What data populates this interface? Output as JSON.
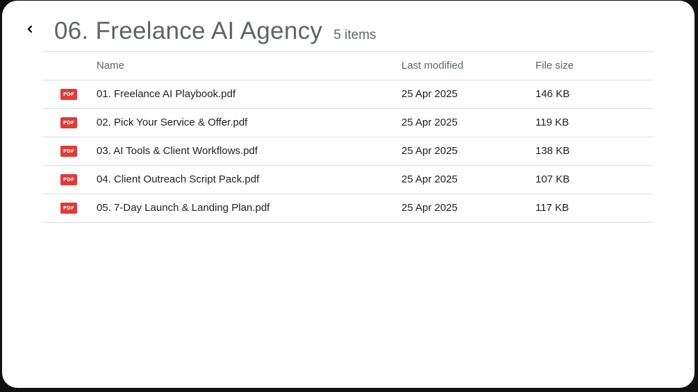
{
  "header": {
    "back_icon": "chevron-left-icon",
    "title": "06. Freelance AI Agency",
    "item_count": "5 items"
  },
  "table": {
    "columns": {
      "name": "Name",
      "last_modified": "Last modified",
      "file_size": "File size"
    },
    "file_icon_label": "PDF",
    "rows": [
      {
        "name": "01. Freelance AI Playbook.pdf",
        "modified": "25 Apr 2025",
        "size": "146 KB"
      },
      {
        "name": "02. Pick Your Service & Offer.pdf",
        "modified": "25 Apr 2025",
        "size": "119 KB"
      },
      {
        "name": "03. AI Tools & Client Workflows.pdf",
        "modified": "25 Apr 2025",
        "size": "138 KB"
      },
      {
        "name": "04. Client Outreach Script Pack.pdf",
        "modified": "25 Apr 2025",
        "size": "107 KB"
      },
      {
        "name": "05. 7-Day Launch & Landing Plan.pdf",
        "modified": "25 Apr 2025",
        "size": "117 KB"
      }
    ]
  },
  "colors": {
    "pdf_icon": "#e53935",
    "text_primary": "#202124",
    "text_secondary": "#5f6368",
    "divider": "#dadce0"
  }
}
